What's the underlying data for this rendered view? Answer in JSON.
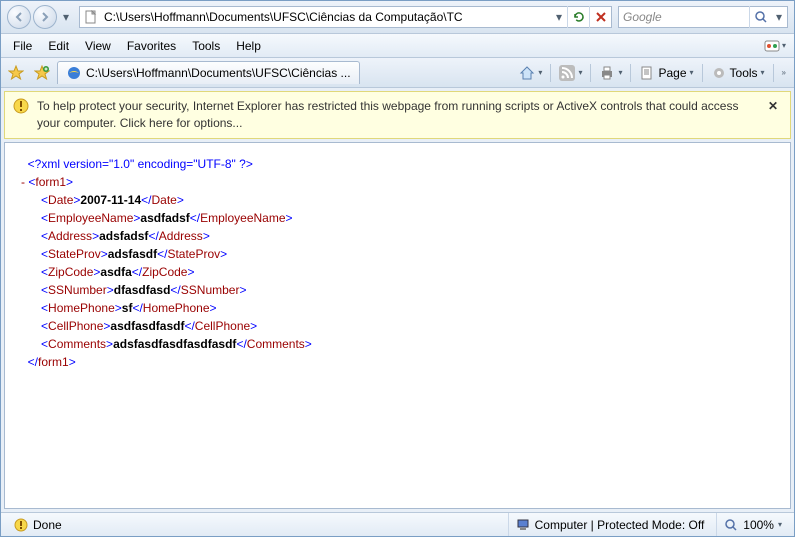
{
  "nav": {
    "address": "C:\\Users\\Hoffmann\\Documents\\UFSC\\Ciências da Computação\\TC",
    "search_placeholder": "Google"
  },
  "menu": {
    "file": "File",
    "edit": "Edit",
    "view": "View",
    "favorites": "Favorites",
    "tools": "Tools",
    "help": "Help"
  },
  "tab": {
    "title": "C:\\Users\\Hoffmann\\Documents\\UFSC\\Ciências ..."
  },
  "cmdbar": {
    "page": "Page",
    "tools": "Tools"
  },
  "infobar": {
    "text": "To help protect your security, Internet Explorer has restricted this webpage from running scripts or ActiveX controls that could access your computer. Click here for options..."
  },
  "xml": {
    "decl": "<?xml version=\"1.0\" encoding=\"UTF-8\" ?>",
    "root": "form1",
    "nodes": [
      {
        "tag": "Date",
        "value": "2007-11-14"
      },
      {
        "tag": "EmployeeName",
        "value": "asdfadsf"
      },
      {
        "tag": "Address",
        "value": "adsfadsf"
      },
      {
        "tag": "StateProv",
        "value": "adsfasdf"
      },
      {
        "tag": "ZipCode",
        "value": "asdfa"
      },
      {
        "tag": "SSNumber",
        "value": "dfasdfasd"
      },
      {
        "tag": "HomePhone",
        "value": "sf"
      },
      {
        "tag": "CellPhone",
        "value": "asdfasdfasdf"
      },
      {
        "tag": "Comments",
        "value": "adsfasdfasdfasdfasdf"
      }
    ]
  },
  "status": {
    "done": "Done",
    "zone": "Computer | Protected Mode: Off",
    "zoom": "100%"
  }
}
